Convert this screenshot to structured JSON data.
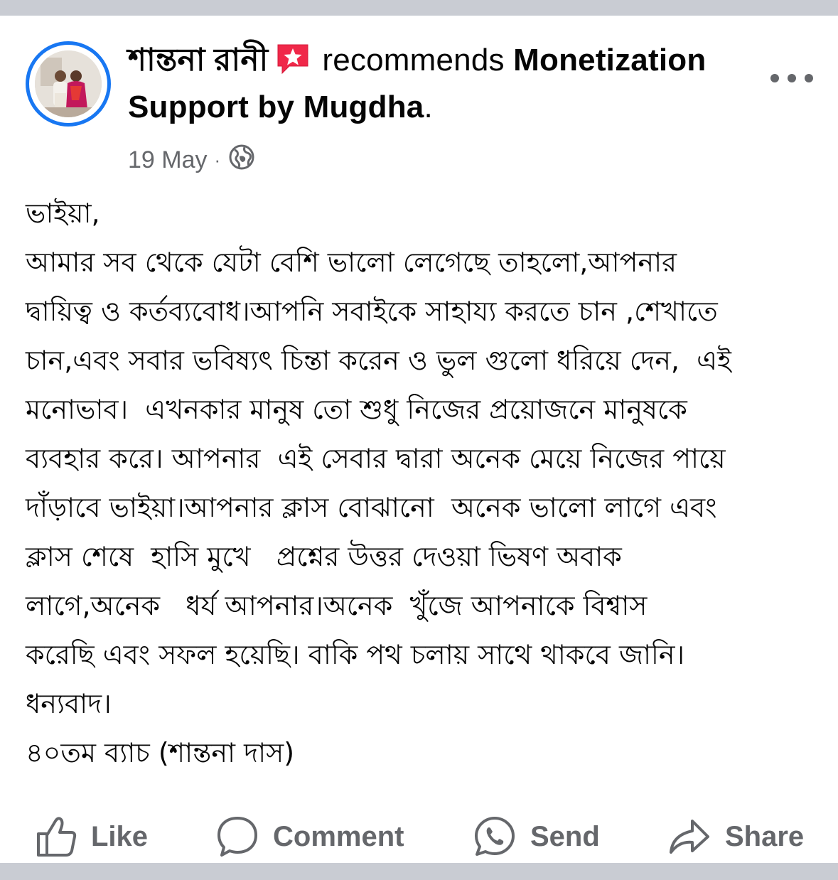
{
  "post": {
    "author": "শান্তনা রানী",
    "recommends_word": "recommends",
    "page_name": "Monetization Support by Mugdha",
    "period": ".",
    "date": "19 May",
    "separator": "·",
    "lines": [
      "ভাইয়া,",
      "আমার সব থেকে যেটা বেশি ভালো লেগেছে তাহলো,আপনার",
      "দ্বায়িত্ব ও কর্তব্যবোধ।আপনি সবাইকে সাহায্য করতে চান ,শেখাতে",
      "চান,এবং সবার ভবিষ্যৎ চিন্তা করেন ও ভুল গুলো ধরিয়ে দেন,  এই",
      "মনোভাব।  এখনকার মানুষ তো শুধু নিজের প্রয়োজনে মানুষকে",
      "ব্যবহার করে। আপনার  এই সেবার দ্বারা অনেক মেয়ে নিজের পায়ে",
      "দাঁড়াবে ভাইয়া।আপনার ক্লাস বোঝানো  অনেক ভালো লাগে এবং",
      "ক্লাস শেষে  হাসি মুখে   প্রশ্নের উত্তর দেওয়া ভিষণ অবাক",
      "লাগে,অনেক   ধর্য আপনার।অনেক  খুঁজে আপনাকে বিশ্বাস",
      "করেছি এবং সফল হয়েছি। বাকি পথ চলায় সাথে থাকবে জানি।",
      "ধন্যবাদ।",
      "৪০তম ব্যাচ (শান্তনা দাস)"
    ]
  },
  "actions": {
    "like": "Like",
    "comment": "Comment",
    "send": "Send",
    "share": "Share"
  },
  "icons": {
    "badge": "recommendation-star-icon",
    "privacy": "globe-icon",
    "more": "more-options-icon",
    "like": "thumbs-up-icon",
    "comment": "comment-bubble-icon",
    "send": "whatsapp-icon",
    "share": "share-arrow-icon"
  },
  "colors": {
    "accent": "#1877f2",
    "badge": "#f02849",
    "muted": "#65676b",
    "text": "#050505"
  }
}
